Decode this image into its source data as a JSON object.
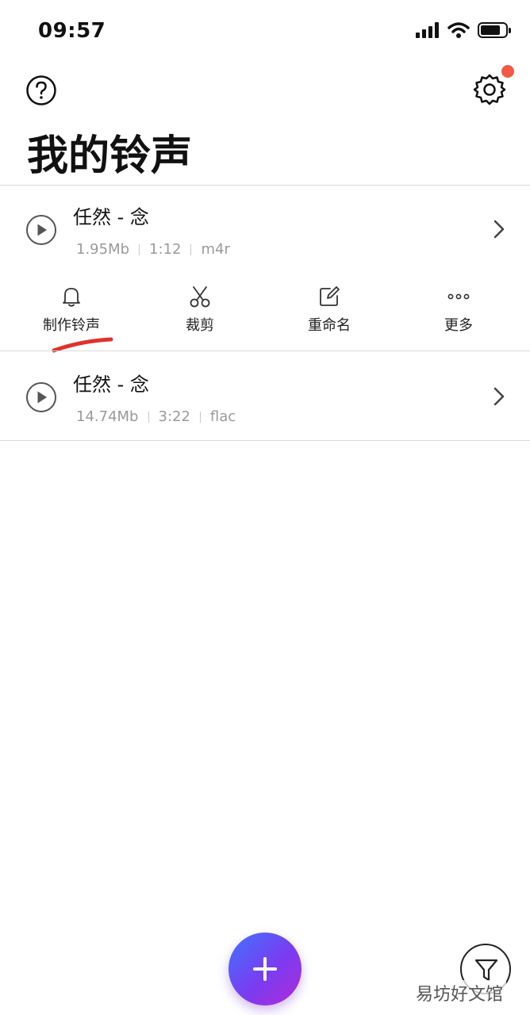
{
  "status_bar": {
    "time": "09:57"
  },
  "header": {
    "title": "我的铃声"
  },
  "songs": [
    {
      "title": "任然 - 念",
      "size": "1.95Mb",
      "duration": "1:12",
      "format": "m4r"
    },
    {
      "title": "任然 - 念",
      "size": "14.74Mb",
      "duration": "3:22",
      "format": "flac"
    }
  ],
  "actions": [
    {
      "label": "制作铃声",
      "icon": "bell-icon"
    },
    {
      "label": "裁剪",
      "icon": "scissors-icon"
    },
    {
      "label": "重命名",
      "icon": "edit-icon"
    },
    {
      "label": "更多",
      "icon": "more-icon"
    }
  ],
  "watermark": "易坊好文馆",
  "colors": {
    "notification_dot": "#f05a46",
    "fab_gradient_start": "#3f73ff",
    "fab_gradient_end": "#b12bd9",
    "annotation_red": "#e0322c"
  },
  "battery_level": 0.8
}
